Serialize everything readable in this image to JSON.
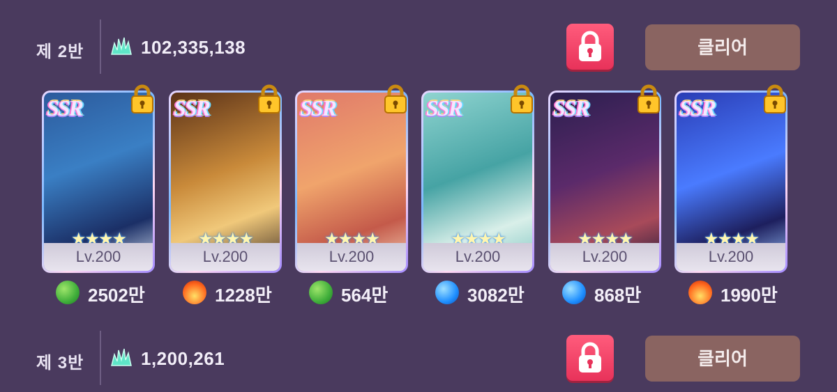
{
  "rows": [
    {
      "class_label": "제 2반",
      "score": "102,335,138",
      "clear_label": "클리어"
    },
    {
      "class_label": "제 3반",
      "score": "1,200,261",
      "clear_label": "클리어"
    }
  ],
  "cards": [
    {
      "rarity": "SSR",
      "stars": "★★★★",
      "level": "Lv.200",
      "element": "leaf-icon",
      "power": "2502만"
    },
    {
      "rarity": "SSR",
      "stars": "★★★★",
      "level": "Lv.200",
      "element": "fire-icon",
      "power": "1228만"
    },
    {
      "rarity": "SSR",
      "stars": "★★★★",
      "level": "Lv.200",
      "element": "leaf-icon",
      "power": "564만"
    },
    {
      "rarity": "SSR",
      "stars": "★★★★",
      "level": "Lv.200",
      "element": "water-icon",
      "power": "3082만"
    },
    {
      "rarity": "SSR",
      "stars": "★★★★",
      "level": "Lv.200",
      "element": "water-icon",
      "power": "868만"
    },
    {
      "rarity": "SSR",
      "stars": "★★★★",
      "level": "Lv.200",
      "element": "fire-icon",
      "power": "1990만"
    }
  ],
  "colors": {
    "background": "#4a3a5e",
    "lock_button": "#e8325a",
    "clear_button": "#8a6461",
    "leaf": "#3fae3a",
    "fire": "#ff6a1f",
    "water": "#1f8fff"
  }
}
